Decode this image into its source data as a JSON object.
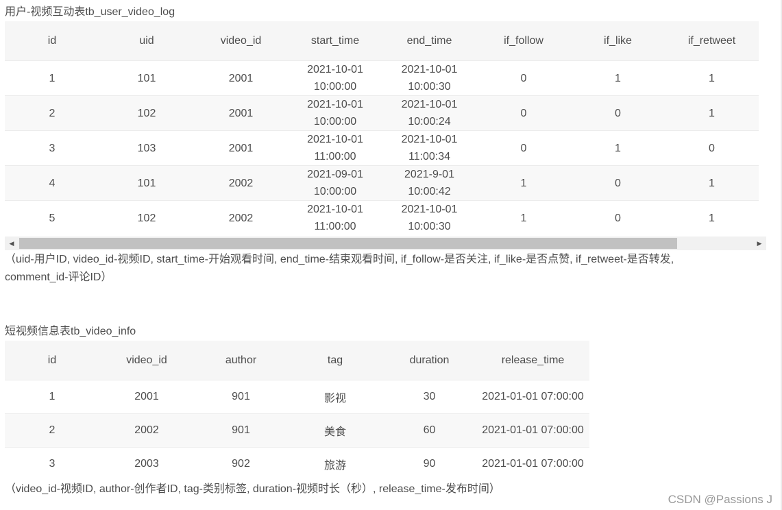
{
  "table1": {
    "caption": "用户-视频互动表tb_user_video_log",
    "columns": [
      "id",
      "uid",
      "video_id",
      "start_time",
      "end_time",
      "if_follow",
      "if_like",
      "if_retweet"
    ],
    "rows": [
      [
        "1",
        "101",
        "2001",
        [
          "2021-10-01",
          "10:00:00"
        ],
        [
          "2021-10-01",
          "10:00:30"
        ],
        "0",
        "1",
        "1"
      ],
      [
        "2",
        "102",
        "2001",
        [
          "2021-10-01",
          "10:00:00"
        ],
        [
          "2021-10-01",
          "10:00:24"
        ],
        "0",
        "0",
        "1"
      ],
      [
        "3",
        "103",
        "2001",
        [
          "2021-10-01",
          "11:00:00"
        ],
        [
          "2021-10-01",
          "11:00:34"
        ],
        "0",
        "1",
        "0"
      ],
      [
        "4",
        "101",
        "2002",
        [
          "2021-09-01",
          "10:00:00"
        ],
        [
          "2021-9-01",
          "10:00:42"
        ],
        "1",
        "0",
        "1"
      ],
      [
        "5",
        "102",
        "2002",
        [
          "2021-10-01",
          "11:00:00"
        ],
        [
          "2021-10-01",
          "10:00:30"
        ],
        "1",
        "0",
        "1"
      ]
    ],
    "note_line1": "（uid-用户ID, video_id-视频ID, start_time-开始观看时间, end_time-结束观看时间, if_follow-是否关注, if_like-是否点赞, if_retweet-是否转发,",
    "note_line2": "comment_id-评论ID）"
  },
  "scrollbar": {
    "left_arrow_icon": "triangle-left",
    "right_arrow_icon": "triangle-right"
  },
  "table2": {
    "caption": "短视频信息表tb_video_info",
    "columns": [
      "id",
      "video_id",
      "author",
      "tag",
      "duration",
      "release_time"
    ],
    "rows": [
      [
        "1",
        "2001",
        "901",
        "影视",
        "30",
        "2021-01-01 07:00:00"
      ],
      [
        "2",
        "2002",
        "901",
        "美食",
        "60",
        "2021-01-01 07:00:00"
      ],
      [
        "3",
        "2003",
        "902",
        "旅游",
        "90",
        "2021-01-01 07:00:00"
      ]
    ],
    "note": "（video_id-视频ID, author-创作者ID, tag-类别标签, duration-视频时长（秒）, release_time-发布时间）"
  },
  "watermark": "CSDN @Passions J"
}
